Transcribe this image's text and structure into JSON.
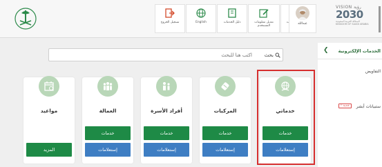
{
  "header": {
    "nav": [
      {
        "label": "تسجيل الخروج",
        "icon": "logout-icon"
      },
      {
        "label": "English",
        "icon": "globe-icon"
      },
      {
        "label": "دليل الخدمات",
        "icon": "book-icon"
      },
      {
        "label": "تعديل معلومات المستخدم",
        "icon": "edit-icon"
      },
      {
        "label": "لوحة المعلومات",
        "icon": "dashboard-icon"
      }
    ],
    "user_name": "عبدالله",
    "vision": {
      "top": "VISION رؤية",
      "year": "2030",
      "sub1": "المملكة العربية السعودية",
      "sub2": "KINGDOM OF SAUDI ARABIA"
    }
  },
  "search": {
    "placeholder": "اكتب هنا للبحث",
    "button_label": "بحث"
  },
  "cards": [
    {
      "title": "مواعيد",
      "icon": "calendar-icon",
      "more_label": "المزيد"
    },
    {
      "title": "العمالة",
      "icon": "workers-icon",
      "services_label": "خدمات",
      "inquiries_label": "إستعلامات"
    },
    {
      "title": "أفراد الأسرة",
      "icon": "family-icon",
      "services_label": "خدمات",
      "inquiries_label": "إستعلامات"
    },
    {
      "title": "المركبات",
      "icon": "vehicle-icon",
      "services_label": "خدمات",
      "inquiries_label": "إستعلامات"
    },
    {
      "title": "خدماتي",
      "icon": "globe-hand-icon",
      "services_label": "خدمات",
      "inquiries_label": "إستعلامات"
    }
  ],
  "sidebar": {
    "title": "الخدمات الإلكترونية",
    "items": [
      "التفاويض",
      "ستبيانات أبشر"
    ],
    "new_badge": "جديد !"
  },
  "colors": {
    "green": "#1e8a46",
    "blue": "#3e7ec3",
    "highlight": "#d62e2e",
    "icon_bg": "#b9d7b8"
  }
}
